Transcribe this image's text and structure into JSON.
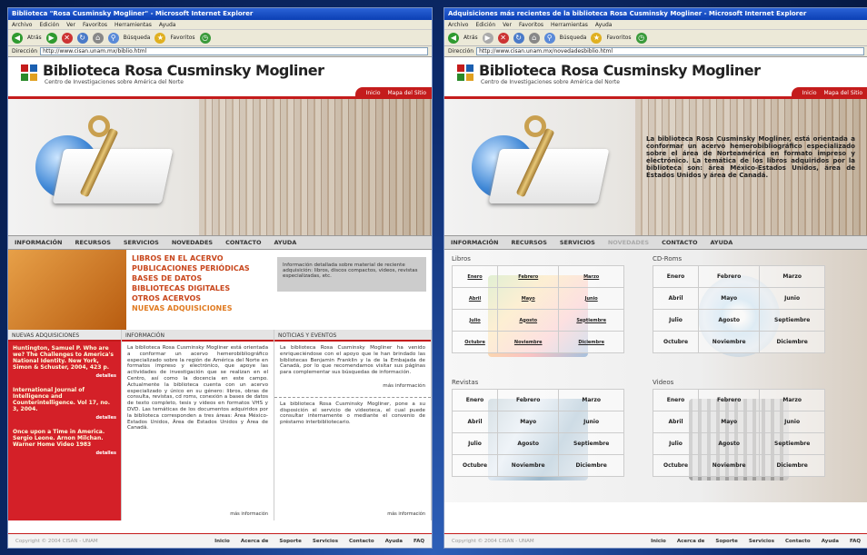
{
  "left": {
    "title": "Biblioteca \"Rosa Cusminsky Mogliner\" - Microsoft Internet Explorer",
    "address": "http://www.cisan.unam.mx/biblio.html",
    "hero_intro": "",
    "feature_links": [
      "LIBROS EN EL ACERVO",
      "PUBLICACIONES PERIÓDICAS",
      "BASES DE DATOS",
      "BIBLIOTECAS DIGITALES",
      "OTROS ACERVOS",
      "NUEVAS ADQUISICIONES"
    ],
    "feature_box": "Información detallada sobre material de reciente adquisición: libros, discos compactos, videos, revistas especializadas, etc.",
    "col1_head": "NUEVAS ADQUISICIONES",
    "col2_head": "INFORMACIÓN",
    "col3_head": "NOTICIAS Y EVENTOS",
    "acq": [
      {
        "text": "Huntington, Samuel P. Who are we? The Challenges to America's National Identity. New York, Simon & Schuster, 2004, 423 p.",
        "more": "detalles"
      },
      {
        "text": "International Journal of Intelligence and Counterintelligence. Vol 17, no. 3, 2004.",
        "more": "detalles"
      },
      {
        "text": "Once upon a Time in America. Sergio Leone. Arnon Milchan. Warner Home Video 1983",
        "more": "detalles"
      }
    ],
    "info_text": "La biblioteca Rosa Cusminsky Mogliner está orientada a conformar un acervo hemerobibliográfico especializado sobre la región de América del Norte en formatos impreso y electrónico, que apoye las actividades de investigación que se realizan en el Centro, así como la docencia en este campo. Actualmente la biblioteca cuenta con un acervo especializado y único en su género: libros, obras de consulta, revistas, cd roms, conexión a bases de datos de texto completo, tesis y videos en formatos VHS y DVD. Las temáticas de los documentos adquiridos por la biblioteca corresponden a tres áreas: Área México-Estados Unidos, Área de Estados Unidos y Área de Canadá.",
    "news1": "La biblioteca Rosa Cusminsky Mogliner ha venido enriqueciéndose con el apoyo que le han brindado las bibliotecas Benjamin Franklin y la de la Embajada de Canadá, por lo que recomendamos visitar sus páginas para complementar sus búsquedas de información.",
    "news2": "La biblioteca Rosa Cusminsky Mogliner, pone a su disposición el servicio de videoteca, el cual puede consultar internamente o mediante el convenio de préstamo interbibliotecario.",
    "more": "más información"
  },
  "right": {
    "title": "Adquisiciones más recientes de la biblioteca Rosa Cusminsky Mogliner - Microsoft Internet Explorer",
    "address": "http://www.cisan.unam.mx/novedadesbiblio.html",
    "hero_intro": "La biblioteca Rosa Cusminsky Mogliner, está orientada a conformar un acervo hemerobibliográfico especializado sobre el área de Norteamérica en formato impreso y electrónico. La temática de los libros adquiridos por la biblioteca son: área México-Estados Unidos, área de Estados Unidos y área de Canadá.",
    "grids": [
      {
        "title": "Libros",
        "months": [
          [
            "Enero",
            "Febrero",
            "Marzo"
          ],
          [
            "Abril",
            "Mayo",
            "Junio"
          ],
          [
            "Julio",
            "Agosto",
            "Septiembre"
          ],
          [
            "Octubre",
            "Noviembre",
            "Diciembre"
          ]
        ]
      },
      {
        "title": "CD-Roms",
        "months": [
          [
            "Enero",
            "Febrero",
            "Marzo"
          ],
          [
            "Abril",
            "Mayo",
            "Junio"
          ],
          [
            "Julio",
            "Agosto",
            "Septiembre"
          ],
          [
            "Octubre",
            "Noviembre",
            "Diciembre"
          ]
        ]
      },
      {
        "title": "Revistas",
        "months": [
          [
            "Enero",
            "Febrero",
            "Marzo"
          ],
          [
            "Abril",
            "Mayo",
            "Junio"
          ],
          [
            "Julio",
            "Agosto",
            "Septiembre"
          ],
          [
            "Octubre",
            "Noviembre",
            "Diciembre"
          ]
        ]
      },
      {
        "title": "Videos",
        "months": [
          [
            "Enero",
            "Febrero",
            "Marzo"
          ],
          [
            "Abril",
            "Mayo",
            "Junio"
          ],
          [
            "Julio",
            "Agosto",
            "Septiembre"
          ],
          [
            "Octubre",
            "Noviembre",
            "Diciembre"
          ]
        ]
      }
    ]
  },
  "common": {
    "menu": [
      "Archivo",
      "Edición",
      "Ver",
      "Favoritos",
      "Herramientas",
      "Ayuda"
    ],
    "toolbar": {
      "back": "Atrás",
      "search": "Búsqueda",
      "favorites": "Favoritos"
    },
    "address_label": "Dirección",
    "site_title": "Biblioteca Rosa Cusminsky Mogliner",
    "site_sub": "Centro de Investigaciones sobre América del Norte",
    "hdr_links": [
      "Inicio",
      "Mapa del Sitio"
    ],
    "nav": [
      "INFORMACIÓN",
      "RECURSOS",
      "SERVICIOS",
      "NOVEDADES",
      "CONTACTO",
      "AYUDA"
    ],
    "copyright": "Copyright © 2004 CISAN - UNAM",
    "footer_links": [
      "Inicio",
      "Acerca de",
      "Soporte",
      "Servicios",
      "Contacto",
      "Ayuda",
      "FAQ"
    ]
  }
}
